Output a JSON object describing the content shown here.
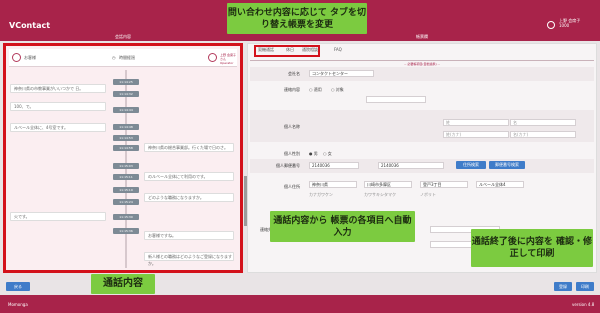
{
  "app": {
    "title": "VContact",
    "user_line1": "上野 会席子",
    "user_line2": "1000",
    "version": "version 4.8",
    "logo": "Momonga"
  },
  "panels": {
    "left_title": "会話内容",
    "right_title": "帳票欄"
  },
  "left": {
    "customer_label": "お客様",
    "time_label": "時間経過",
    "operator_line1": "上野 会席子 さん",
    "operator_line2": "Operator",
    "messages": [
      {
        "side": "l",
        "text": "神奈川県の市教事業がいいつかで 日。"
      },
      {
        "side": "l",
        "text": "100、で。"
      },
      {
        "side": "l",
        "text": "ルベール全体に、4号室です。"
      },
      {
        "side": "r",
        "text": "神奈川県の総合事業部。行くた場で日のさ。"
      },
      {
        "side": "r",
        "text": "のルベール全体にて利用のです。"
      },
      {
        "side": "r",
        "text": "どのような職務になりますか。"
      },
      {
        "side": "l",
        "text": "火です。"
      },
      {
        "side": "r",
        "text": "お客様ですね。"
      },
      {
        "side": "r",
        "text": "新人様との職務はどのようなご登録になりますか。"
      }
    ],
    "times": [
      "11:14:25",
      "11:14:32",
      "11:14:44",
      "11:14:48",
      "11:14:53",
      "11:14:58",
      "11:15:03",
      "11:15:11",
      "11:15:19",
      "11:15:24",
      "11:15:30",
      "11:15:36"
    ]
  },
  "right": {
    "tabs": [
      "契機通話",
      "休日",
      "通院相談",
      "FAQ"
    ],
    "section": "-- 必要帳項目(自動連携) --",
    "fields": {
      "company_label": "会社名",
      "company_value": "コンタクトセンター",
      "contact_label": "連絡内容",
      "contact_opt1": "○ 適用",
      "contact_opt2": "○ 対象",
      "name_label": "個人名称",
      "name_ph1": "姓",
      "name_ph2": "名",
      "name_ph3": "姓(カナ)",
      "name_ph4": "名(カナ)",
      "gender_label": "個人性別",
      "gender_opt1": "● 男",
      "gender_opt2": "○ 女",
      "zip_label": "個人郵便番号",
      "zip1": "2140036",
      "zip2": "2140036",
      "btn_zip": "住所検索",
      "btn_confirm": "郵便番号検索",
      "addr_label": "個人住所",
      "addr1": "神奈川県",
      "addr2": "川崎市多摩区",
      "addr3": "登戸3丁目",
      "addr4": "ルベール全体4",
      "addr_kana1": "カナガワケン",
      "addr_kana2": "カワサキシタマク",
      "addr_kana3": "ノボリト",
      "addr_kana4": "",
      "extra_label": "連絡先"
    }
  },
  "callouts": {
    "top": "問い合わせ内容に応じて タブを切り替え帳票を変更",
    "mid": "通話内容から 帳票の各項目へ自動入力",
    "bottom_right": "通話終了後に内容を 確認・修正して印刷",
    "bottom_left": "通話内容"
  },
  "buttons": {
    "back": "戻る",
    "save": "登録",
    "print": "印刷"
  }
}
